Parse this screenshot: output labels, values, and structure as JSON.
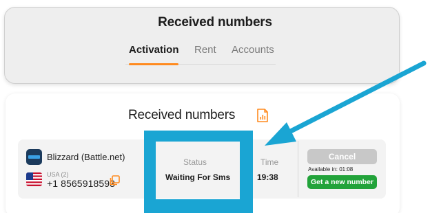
{
  "header": {
    "title": "Received numbers",
    "tabs": [
      {
        "label": "Activation",
        "active": true
      },
      {
        "label": "Rent",
        "active": false
      },
      {
        "label": "Accounts",
        "active": false
      }
    ]
  },
  "main": {
    "title": "Received numbers",
    "report_icon": "report-icon",
    "row": {
      "service": {
        "name": "Blizzard (Battle.net)",
        "icon": "blizzard-icon"
      },
      "country": {
        "label": "USA (2)",
        "flag": "usa-flag-icon"
      },
      "phone": "+1 8565918593",
      "copy_icon": "copy-icon",
      "status": {
        "label": "Status",
        "value": "Waiting For Sms"
      },
      "time": {
        "label": "Time",
        "value": "19:38"
      },
      "cancel_label": "Cancel",
      "available_text": "Available in: 01:08",
      "new_number_label": "Get a new number"
    }
  },
  "colors": {
    "accent": "#ff8a1e",
    "annotation": "#1aa5d3",
    "success": "#22a33a",
    "disabled": "#c8c8c8"
  }
}
